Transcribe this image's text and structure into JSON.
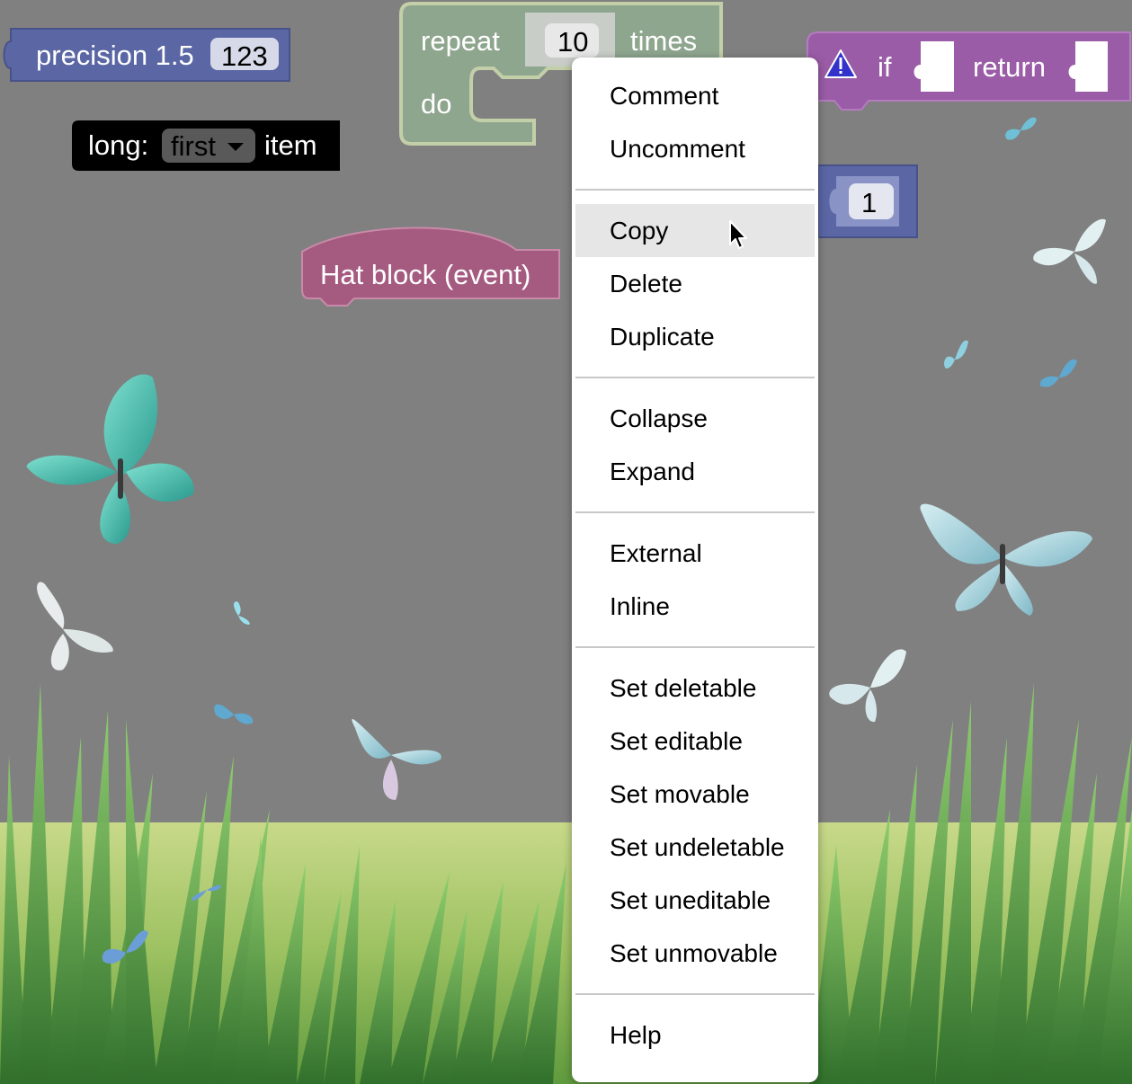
{
  "blocks": {
    "precision": {
      "label": "precision 1.5",
      "value": "123",
      "color": "#5b67a5"
    },
    "repeat": {
      "label_repeat": "repeat",
      "count": "10",
      "label_times": "times",
      "label_do": "do",
      "color": "#8ea58e"
    },
    "long_item": {
      "label_long": "long:",
      "dropdown_value": "first",
      "label_item": "item",
      "color": "#000000"
    },
    "hat": {
      "label": "Hat block (event)",
      "color": "#a55b80"
    },
    "if_return": {
      "label_if": "if",
      "label_return": "return",
      "color": "#9a5ca6"
    },
    "number": {
      "value": "1",
      "color": "#5b67a5"
    }
  },
  "context_menu": {
    "groups": [
      [
        {
          "label": "Comment"
        },
        {
          "label": "Uncomment"
        }
      ],
      [
        {
          "label": "Copy",
          "highlighted": true
        },
        {
          "label": "Delete"
        },
        {
          "label": "Duplicate"
        }
      ],
      [
        {
          "label": "Collapse"
        },
        {
          "label": "Expand"
        }
      ],
      [
        {
          "label": "External"
        },
        {
          "label": "Inline"
        }
      ],
      [
        {
          "label": "Set deletable"
        },
        {
          "label": "Set editable"
        },
        {
          "label": "Set movable"
        },
        {
          "label": "Set undeletable"
        },
        {
          "label": "Set uneditable"
        },
        {
          "label": "Set unmovable"
        }
      ],
      [
        {
          "label": "Help"
        }
      ]
    ]
  },
  "icons": {
    "warning": "warning-icon",
    "cursor": "mouse-pointer-icon",
    "dropdown": "dropdown-arrow-icon"
  }
}
